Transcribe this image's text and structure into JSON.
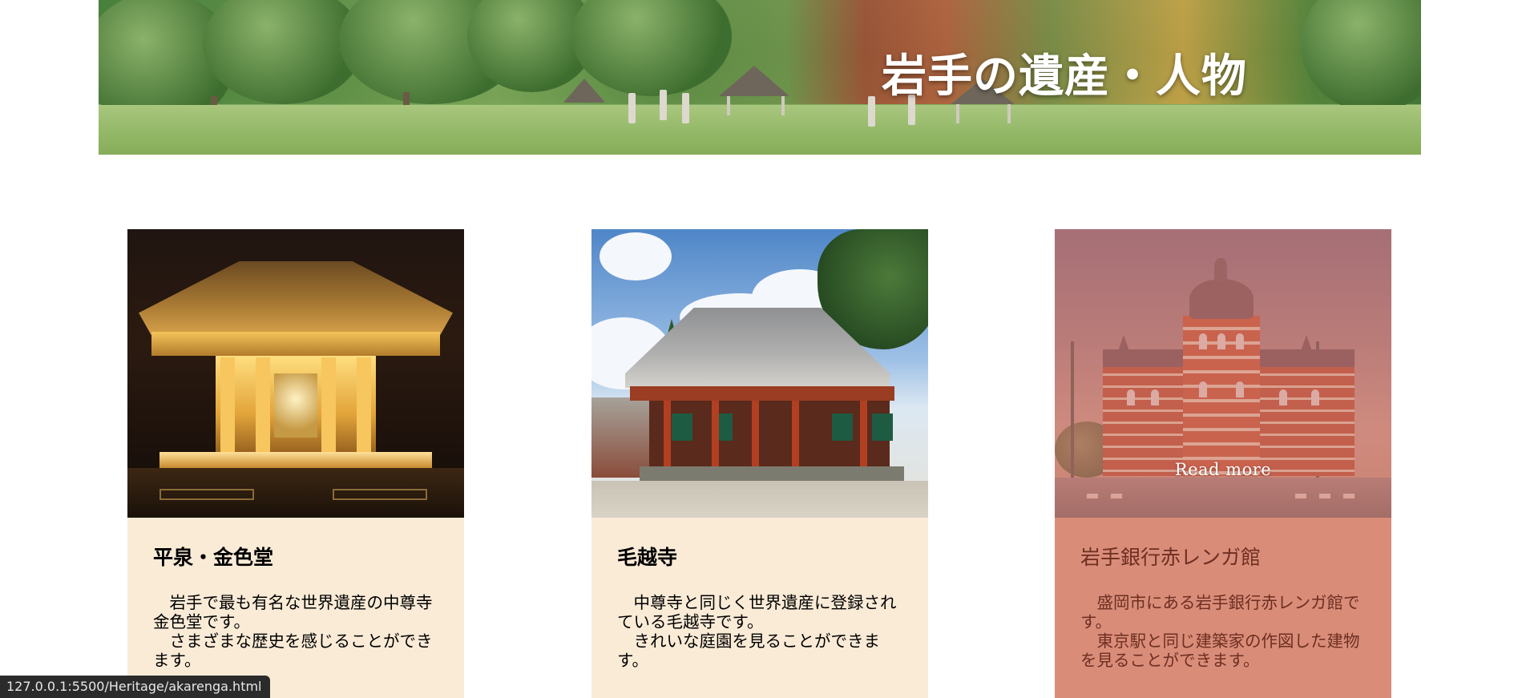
{
  "hero": {
    "title": "岩手の遺産・人物"
  },
  "cards": [
    {
      "title": "平泉・金色堂",
      "paragraphs": [
        "岩手で最も有名な世界遺産の中尊寺金色堂です。",
        "さまざまな歴史を感じることができます。"
      ]
    },
    {
      "title": "毛越寺",
      "paragraphs": [
        "中尊寺と同じく世界遺産に登録されている毛越寺です。",
        "きれいな庭園を見ることができます。"
      ]
    },
    {
      "title": "岩手銀行赤レンガ館",
      "hover_label": "Read more",
      "paragraphs": [
        "盛岡市にある岩手銀行赤レンガ館です。",
        "東京駅と同じ建築家の作図した建物を見ることができます。"
      ]
    }
  ],
  "status_bar": {
    "url": "127.0.0.1:5500/Heritage/akarenga.html"
  },
  "colors": {
    "card_background": "#faebd7",
    "card_hover_background": "#d98d78",
    "hover_text": "#6e2e22"
  }
}
